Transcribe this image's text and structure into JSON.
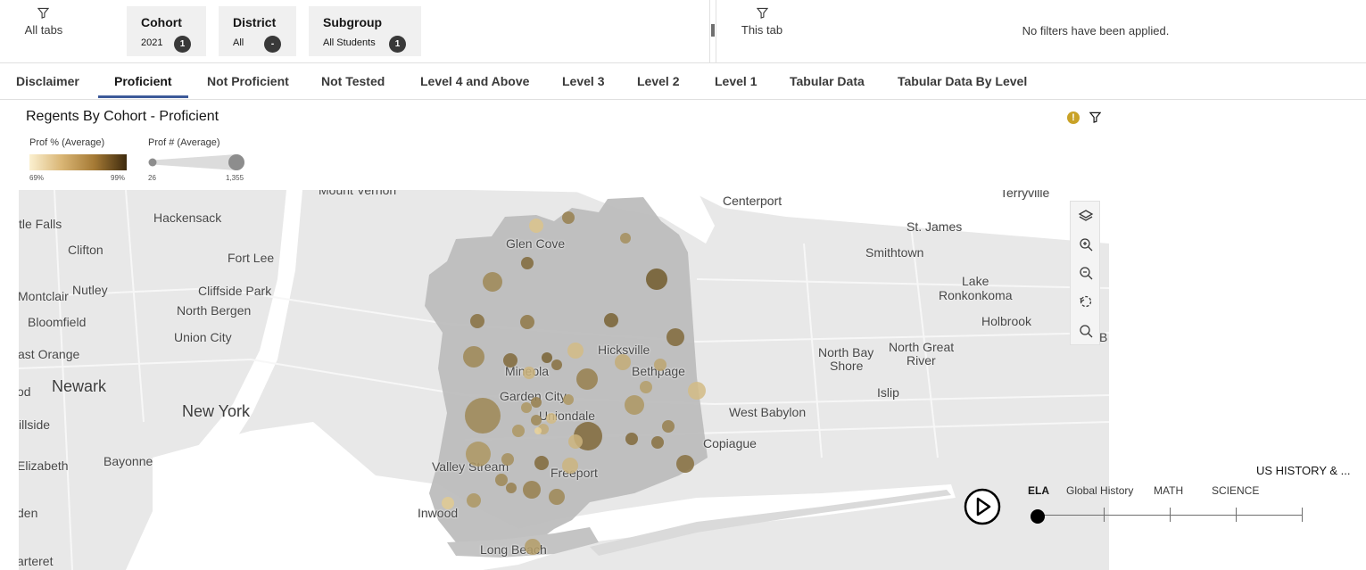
{
  "filters": {
    "all_tabs": {
      "label": "All tabs",
      "icon": "filter-icon"
    },
    "chips": [
      {
        "title": "Cohort",
        "value": "2021",
        "badge": "1"
      },
      {
        "title": "District",
        "value": "All",
        "badge": "-"
      },
      {
        "title": "Subgroup",
        "value": "All Students",
        "badge": "1"
      }
    ],
    "this_tab": {
      "label": "This tab",
      "icon": "filter-icon"
    },
    "empty_message": "No filters have been applied."
  },
  "tabs": [
    {
      "label": "Disclaimer",
      "active": false
    },
    {
      "label": "Proficient",
      "active": true
    },
    {
      "label": "Not Proficient",
      "active": false
    },
    {
      "label": "Not Tested",
      "active": false
    },
    {
      "label": "Level 4 and Above",
      "active": false
    },
    {
      "label": "Level 3",
      "active": false
    },
    {
      "label": "Level 2",
      "active": false
    },
    {
      "label": "Level 1",
      "active": false
    },
    {
      "label": "Tabular Data",
      "active": false
    },
    {
      "label": "Tabular Data By Level",
      "active": false
    }
  ],
  "widget": {
    "title": "Regents By Cohort - Proficient",
    "warning_icon": "!",
    "legend_color": {
      "title": "Prof % (Average)",
      "min": "69%",
      "max": "99%"
    },
    "legend_size": {
      "title": "Prof # (Average)",
      "min": "26",
      "max": "1,355"
    }
  },
  "map": {
    "places": [
      "Mount Vernon",
      "Terryville",
      "Centerport",
      "tle Falls",
      "Hackensack",
      "Glen Cove",
      "St. James",
      "Clifton",
      "Fort Lee",
      "Smithtown",
      "Nutley",
      "Cliffside Park",
      "Lake",
      "Montclair",
      "Ronkonkoma",
      "North Bergen",
      "Bloomfield",
      "Holbrook",
      "Union City",
      "Hicksville",
      "B",
      "North Bay",
      "North Great",
      "ast Orange",
      "Mineola",
      "Bethpage",
      "Shore",
      "River",
      "Newark",
      "Garden City",
      "Islip",
      "od",
      "New York",
      "Uniondale",
      "West Babylon",
      "Copiague",
      "illside",
      "Bayonne",
      "Valley Stream",
      "Freeport",
      "Elizabeth",
      "Inwood",
      "den",
      "Long Beach",
      "arteret"
    ],
    "tools": [
      "layers-icon",
      "zoom-in-icon",
      "zoom-out-icon",
      "reset-icon",
      "search-icon"
    ]
  },
  "timeline": {
    "extra_label": "US HISTORY & ...",
    "steps": [
      "ELA",
      "Global History",
      "MATH",
      "SCIENCE"
    ],
    "active_step": "ELA",
    "play_icon": "play-icon"
  },
  "colors": {
    "active_tab_underline": "#3d5a99",
    "bubble_light": "#f0d9a0",
    "bubble_dark": "#5a4317",
    "region_fill": "#bdbdbd"
  }
}
